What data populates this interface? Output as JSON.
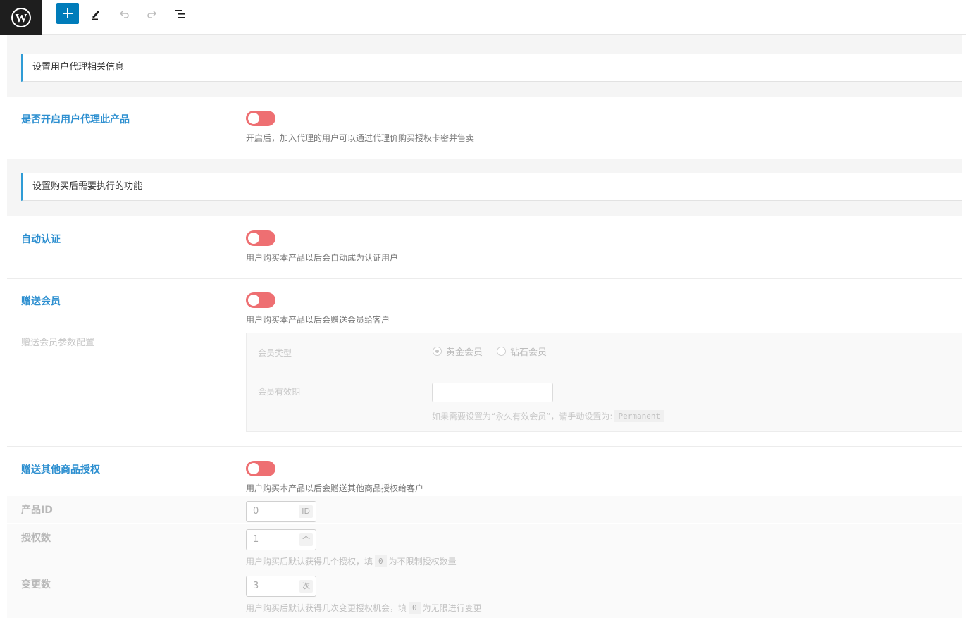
{
  "toolbar": {
    "logo_icon": "wordpress-icon",
    "add_icon": "plus-icon",
    "edit_icon": "pencil-icon",
    "undo_icon": "undo-icon",
    "redo_icon": "redo-icon",
    "list_icon": "list-view-icon",
    "accent_color": "#007cba"
  },
  "section1": {
    "heading": "设置用户代理相关信息",
    "agent": {
      "title": "是否开启用户代理此产品",
      "desc": "开启后，加入代理的用户可以通过代理价购买授权卡密并售卖"
    }
  },
  "section2": {
    "heading": "设置购买后需要执行的功能",
    "auto_auth": {
      "title": "自动认证",
      "desc": "用户购买本产品以后会自动成为认证用户"
    },
    "gift_vip": {
      "title": "赠送会员",
      "desc": "用户购买本产品以后会赠送会员给客户",
      "config_title": "赠送会员参数配置",
      "type_label": "会员类型",
      "options": [
        "黄金会员",
        "钻石会员"
      ],
      "selected": "黄金会员",
      "validity_label": "会员有效期",
      "validity_value": "",
      "validity_hint_prefix": "如果需要设置为“永久有效会员”，请手动设置为:",
      "validity_hint_code": "Permanent"
    },
    "gift_product": {
      "title": "赠送其他商品授权",
      "desc": "用户购买本产品以后会赠送其他商品授权给客户",
      "product_id_label": "产品ID",
      "product_id_value": "0",
      "product_id_suffix": "ID",
      "auth_count_label": "授权数",
      "auth_count_value": "1",
      "auth_count_suffix": "个",
      "auth_count_hint_prefix": "用户购买后默认获得几个授权，填",
      "auth_count_hint_code": "0",
      "auth_count_hint_suffix": "为不限制授权数量",
      "change_count_label": "变更数",
      "change_count_value": "3",
      "change_count_suffix": "次",
      "change_count_hint_prefix": "用户购买后默认获得几次变更授权机会，填",
      "change_count_hint_code": "0",
      "change_count_hint_suffix": "为无限进行变更"
    }
  },
  "toggle_color": "#ee6f72",
  "title_color": "#2d8fd0"
}
